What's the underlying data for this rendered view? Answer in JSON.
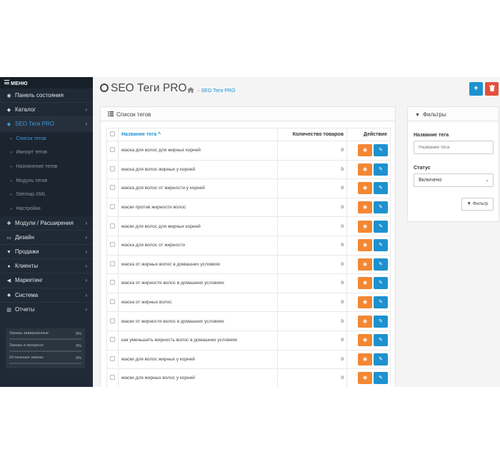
{
  "sidebar": {
    "menu_label": "МЕНЮ",
    "items": [
      {
        "label": "Панель состояния",
        "icon": "dashboard-icon",
        "glyph": "◉"
      },
      {
        "label": "Каталог",
        "icon": "tag-icon",
        "glyph": "◆",
        "chevron": "›"
      },
      {
        "label": "SEO Теги PRO",
        "icon": "seo-tag-icon",
        "glyph": "◆",
        "chevron": "›"
      }
    ],
    "subitems": [
      {
        "label": "Список тегов"
      },
      {
        "label": "Импорт тегов"
      },
      {
        "label": "Назначение тегов"
      },
      {
        "label": "Модуль тегов"
      },
      {
        "label": "Sitemap XML"
      },
      {
        "label": "Настройки"
      }
    ],
    "sub_bullet": "»",
    "items2": [
      {
        "label": "Модули / Расширения",
        "icon": "puzzle-icon",
        "glyph": "✚",
        "chevron": "›"
      },
      {
        "label": "Дизайн",
        "icon": "monitor-icon",
        "glyph": "▭",
        "chevron": "›"
      },
      {
        "label": "Продажи",
        "icon": "cart-icon",
        "glyph": "▼",
        "chevron": "›"
      },
      {
        "label": "Клиенты",
        "icon": "user-icon",
        "glyph": "●",
        "chevron": "›"
      },
      {
        "label": "Маркетинг",
        "icon": "share-icon",
        "glyph": "◀",
        "chevron": "›"
      },
      {
        "label": "Система",
        "icon": "gear-icon",
        "glyph": "✸",
        "chevron": "›"
      },
      {
        "label": "Отчеты",
        "icon": "bar-chart-icon",
        "glyph": "▥",
        "chevron": "›"
      }
    ],
    "stats": [
      {
        "label": "Заказы завершенные",
        "value": "0%",
        "fraction": 0
      },
      {
        "label": "Заказы в процессе",
        "value": "0%",
        "fraction": 0
      },
      {
        "label": "Остальные заказы",
        "value": "0%",
        "fraction": 0
      }
    ]
  },
  "header": {
    "title": "SEO Теги PRO",
    "breadcrumb_sep": "›",
    "breadcrumb": "SEO Теги PRO",
    "add_glyph": "+",
    "delete_glyph": "🗑"
  },
  "list": {
    "heading": "Список тегов",
    "columns": {
      "name": "Название тега ^",
      "qty": "Количество товаров",
      "action": "Действие"
    },
    "view_glyph": "◉",
    "edit_glyph": "✎",
    "rows": [
      {
        "name": "маска для волос для жирных корней",
        "qty": "0"
      },
      {
        "name": "маска для волос жирных у корней",
        "qty": "0"
      },
      {
        "name": "маска для волос от жирности у корней",
        "qty": "0"
      },
      {
        "name": "маски против жирности волос",
        "qty": "0"
      },
      {
        "name": "маски для волос для жирных корней",
        "qty": "0"
      },
      {
        "name": "маска для волос от жирности",
        "qty": "0"
      },
      {
        "name": "маска от жирных волос в домашних условиях",
        "qty": "0"
      },
      {
        "name": "маска от жирности волос в домашних условиях",
        "qty": "0"
      },
      {
        "name": "маска от жирных волос",
        "qty": "0"
      },
      {
        "name": "маски от жирности волос в домашних условиях",
        "qty": "0"
      },
      {
        "name": "как уменьшить жирность волос в домашних условиях",
        "qty": "0"
      },
      {
        "name": "маски для волос жирных у корней",
        "qty": "0"
      },
      {
        "name": "маски для жирных волос у корней",
        "qty": "0"
      }
    ]
  },
  "filters": {
    "heading": "Фильтры",
    "name_label": "Название тега",
    "name_placeholder": "Название тега",
    "status_label": "Статус",
    "status_value": "Включено",
    "status_chevron": "⌄",
    "button": "Фильтр",
    "button_glyph": "▼"
  },
  "colors": {
    "accent": "#1e91cf",
    "danger": "#e3503e",
    "view": "#f38733",
    "sidebar": "#1f2a36"
  }
}
